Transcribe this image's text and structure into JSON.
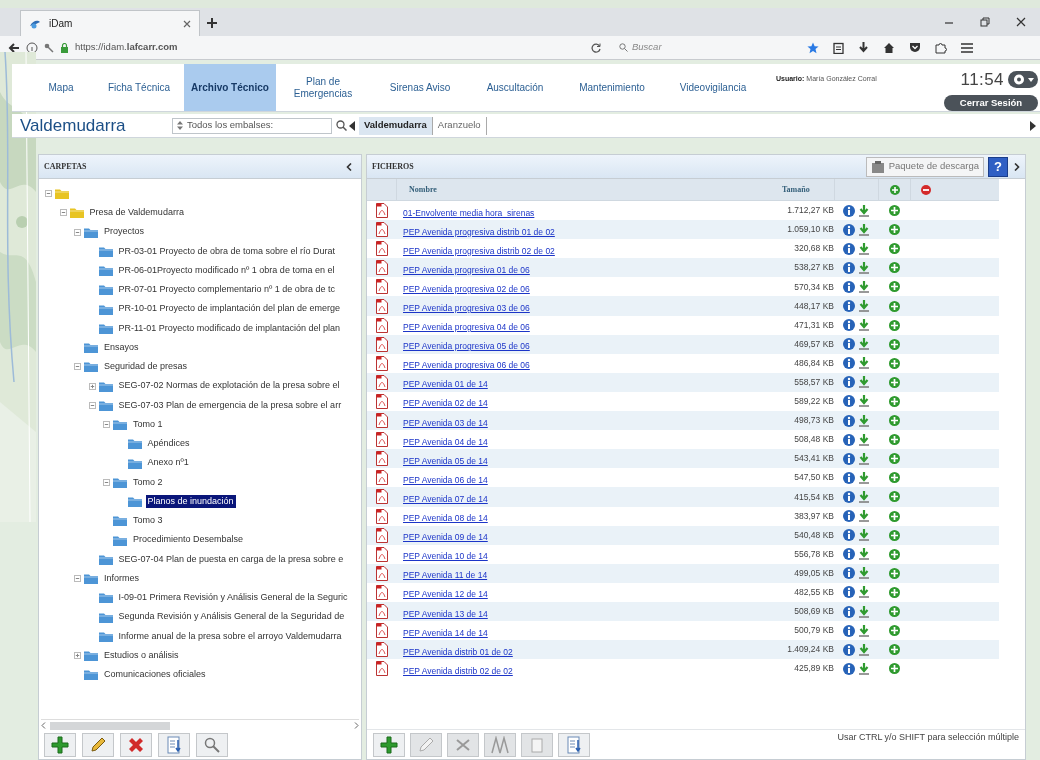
{
  "browser": {
    "tab_title": "iDam",
    "url": "https://idam.**lafcarr.com**",
    "search_placeholder": "Buscar"
  },
  "nav": {
    "items": [
      {
        "label": "Mapa",
        "selected": false
      },
      {
        "label": "Ficha Técnica",
        "selected": false
      },
      {
        "label": "Archivo Técnico",
        "selected": true
      },
      {
        "label": "Plan de Emergencias",
        "selected": false
      },
      {
        "label": "Sirenas Aviso",
        "selected": false
      },
      {
        "label": "Auscultación",
        "selected": false
      },
      {
        "label": "Mantenimiento",
        "selected": false
      },
      {
        "label": "Videovigilancia",
        "selected": false
      }
    ],
    "user_label": "Usuario:",
    "user_name": "María González Corral",
    "time": "11:54",
    "logout": "Cerrar Sesión"
  },
  "subbar": {
    "title": "Valdemudarra",
    "selector": "Todos los embalses:",
    "tabs": [
      {
        "label": "Valdemudarra",
        "selected": true
      },
      {
        "label": "Aranzuelo",
        "selected": false
      }
    ]
  },
  "folders": {
    "title": "CARPETAS",
    "tree": [
      {
        "kind": "dam",
        "expanded": true,
        "children": [
          {
            "kind": "dam",
            "label": "Presa de Valdemudarra",
            "expanded": true,
            "selected": false,
            "children": [
              {
                "label": "Proyectos",
                "expanded": true,
                "selected": false,
                "children": [
                  {
                    "label": "PR-03-01 Proyecto de obra de toma sobre el río Durat",
                    "selected": false
                  },
                  {
                    "label": "PR-06-01Proyecto modificado nº 1 obra de toma en el",
                    "selected": false
                  },
                  {
                    "label": "PR-07-01 Proyecto complementario nº 1 de obra de tc",
                    "selected": false
                  },
                  {
                    "label": "PR-10-01 Proyecto de implantación del plan de emerge",
                    "selected": false
                  },
                  {
                    "label": "PR-11-01 Proyecto modificado de implantación del plan",
                    "selected": false
                  }
                ]
              },
              {
                "label": "Ensayos",
                "selected": false
              },
              {
                "label": "Seguridad de presas",
                "expanded": true,
                "selected": false,
                "children": [
                  {
                    "label": "SEG-07-02 Normas de explotación de la presa sobre el",
                    "expanded": false,
                    "selected": false
                  },
                  {
                    "label": "SEG-07-03 Plan de emergencia de la presa sobre el arr",
                    "expanded": true,
                    "selected": false,
                    "children": [
                      {
                        "label": "Tomo 1",
                        "expanded": true,
                        "selected": false,
                        "children": [
                          {
                            "label": "Apéndices",
                            "selected": false
                          },
                          {
                            "label": "Anexo nº1",
                            "selected": false
                          }
                        ]
                      },
                      {
                        "label": "Tomo 2",
                        "expanded": true,
                        "selected": false,
                        "children": [
                          {
                            "label": "Planos de inundación",
                            "selected": true
                          }
                        ]
                      },
                      {
                        "label": "Tomo 3",
                        "selected": false
                      },
                      {
                        "label": "Procedimiento Desembalse",
                        "selected": false
                      }
                    ]
                  },
                  {
                    "label": "SEG-07-04 Plan de puesta en carga de la presa sobre e",
                    "selected": false
                  }
                ]
              },
              {
                "label": "Informes",
                "expanded": true,
                "selected": false,
                "children": [
                  {
                    "label": "I-09-01 Primera Revisión y Análisis General de la Seguric",
                    "selected": false
                  },
                  {
                    "label": "Segunda Revisión y Análisis General de la Seguridad de",
                    "selected": false
                  },
                  {
                    "label": "Informe anual de la presa sobre el arroyo Valdemudarra",
                    "selected": false
                  }
                ]
              },
              {
                "label": "Estudios o análisis",
                "expanded": false,
                "selected": false
              },
              {
                "label": "Comunicaciones oficiales",
                "selected": false
              }
            ]
          }
        ]
      }
    ]
  },
  "files": {
    "title": "FICHEROS",
    "package_button": "Paquete de descarga",
    "help": "?",
    "columns": [
      "Nombre",
      "Tamaño"
    ],
    "rows": [
      {
        "name": "01-Envolvente media hora_sirenas",
        "size": "1.712,27 KB"
      },
      {
        "name": "PEP Avenida progresiva distrib 01 de 02",
        "size": "1.059,10 KB"
      },
      {
        "name": "PEP Avenida progresiva distrib 02 de 02",
        "size": "320,68 KB"
      },
      {
        "name": "PEP Avenida progresiva 01 de 06",
        "size": "538,27 KB"
      },
      {
        "name": "PEP Avenida progresiva 02 de 06",
        "size": "570,34 KB"
      },
      {
        "name": "PEP Avenida progresiva 03 de 06",
        "size": "448,17 KB"
      },
      {
        "name": "PEP Avenida progresiva 04 de 06",
        "size": "471,31 KB"
      },
      {
        "name": "PEP Avenida progresiva 05 de 06",
        "size": "469,57 KB"
      },
      {
        "name": "PEP Avenida progresiva 06 de 06",
        "size": "486,84 KB"
      },
      {
        "name": "PEP Avenida 01 de 14",
        "size": "558,57 KB"
      },
      {
        "name": "PEP Avenida 02 de 14",
        "size": "589,22 KB"
      },
      {
        "name": "PEP Avenida 03 de 14",
        "size": "498,73 KB"
      },
      {
        "name": "PEP Avenida 04 de 14",
        "size": "508,48 KB"
      },
      {
        "name": "PEP Avenida 05 de 14",
        "size": "543,41 KB"
      },
      {
        "name": "PEP Avenida 06 de 14",
        "size": "547,50 KB"
      },
      {
        "name": "PEP Avenida 07 de 14",
        "size": "415,54 KB"
      },
      {
        "name": "PEP Avenida 08 de 14",
        "size": "383,97 KB"
      },
      {
        "name": "PEP Avenida 09 de 14",
        "size": "540,48 KB"
      },
      {
        "name": "PEP Avenida 10 de 14",
        "size": "556,78 KB"
      },
      {
        "name": "PEP Avenida 11 de 14",
        "size": "499,05 KB"
      },
      {
        "name": "PEP Avenida 12 de 14",
        "size": "482,55 KB"
      },
      {
        "name": "PEP Avenida 13 de 14",
        "size": "508,69 KB"
      },
      {
        "name": "PEP Avenida 14 de 14",
        "size": "500,79 KB"
      },
      {
        "name": "PEP Avenida distrib 01 de 02",
        "size": "1.409,24 KB"
      },
      {
        "name": "PEP Avenida distrib 02 de 02",
        "size": "425,89 KB"
      }
    ],
    "hint": "Usar CTRL y/o SHIFT para selección múltiple"
  }
}
